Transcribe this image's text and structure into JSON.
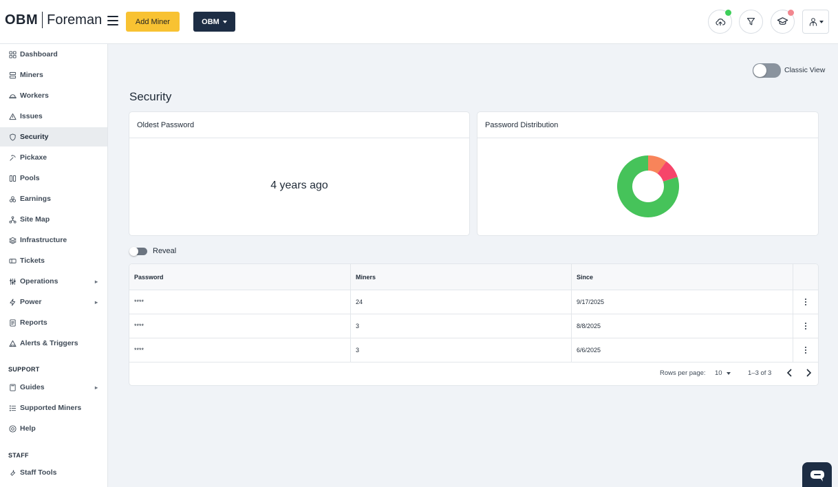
{
  "header": {
    "logo_brand": "OBM",
    "logo_product": "Foreman",
    "add_miner_label": "Add Miner",
    "org_label": "OBM",
    "upload_status_color": "#3ecf5a",
    "academy_status_color": "#f2878f"
  },
  "sidebar": {
    "items": [
      {
        "label": "Dashboard",
        "icon": "dashboard-icon"
      },
      {
        "label": "Miners",
        "icon": "miners-icon"
      },
      {
        "label": "Workers",
        "icon": "workers-icon"
      },
      {
        "label": "Issues",
        "icon": "warning-icon"
      },
      {
        "label": "Security",
        "icon": "shield-icon",
        "active": true
      },
      {
        "label": "Pickaxe",
        "icon": "pickaxe-icon"
      },
      {
        "label": "Pools",
        "icon": "pools-icon"
      },
      {
        "label": "Earnings",
        "icon": "earnings-icon"
      },
      {
        "label": "Site Map",
        "icon": "sitemap-icon"
      },
      {
        "label": "Infrastructure",
        "icon": "layers-icon"
      },
      {
        "label": "Tickets",
        "icon": "ticket-icon"
      },
      {
        "label": "Operations",
        "icon": "sliders-icon",
        "has_submenu": true
      },
      {
        "label": "Power",
        "icon": "lightning-icon",
        "has_submenu": true
      },
      {
        "label": "Reports",
        "icon": "report-icon"
      },
      {
        "label": "Alerts & Triggers",
        "icon": "alert-icon"
      }
    ],
    "support_label": "SUPPORT",
    "support_items": [
      {
        "label": "Guides",
        "icon": "book-icon",
        "has_submenu": true
      },
      {
        "label": "Supported Miners",
        "icon": "list-icon"
      },
      {
        "label": "Help",
        "icon": "help-icon"
      }
    ],
    "staff_label": "STAFF",
    "staff_items": [
      {
        "label": "Staff Tools",
        "icon": "tools-icon"
      }
    ]
  },
  "main": {
    "classic_view_label": "Classic View",
    "classic_view_on": false,
    "title": "Security",
    "oldest_password": {
      "title": "Oldest Password",
      "value": "4 years ago"
    },
    "distribution": {
      "title": "Password Distribution"
    },
    "reveal_label": "Reveal",
    "reveal_on": false,
    "table": {
      "columns": [
        "Password",
        "Miners",
        "Since",
        ""
      ],
      "rows": [
        {
          "password": "****",
          "miners": "24",
          "since": "9/17/2025"
        },
        {
          "password": "****",
          "miners": "3",
          "since": "8/8/2025"
        },
        {
          "password": "****",
          "miners": "3",
          "since": "6/6/2025"
        }
      ],
      "rows_per_page_label": "Rows per page:",
      "rows_per_page_value": "10",
      "range_text": "1–3 of 3"
    }
  },
  "chart_data": {
    "type": "pie",
    "title": "",
    "donut": true,
    "slices": [
      {
        "value": 24,
        "color": "#46c35a"
      },
      {
        "value": 3,
        "color": "#f8845a"
      },
      {
        "value": 3,
        "color": "#f6456a"
      }
    ]
  }
}
